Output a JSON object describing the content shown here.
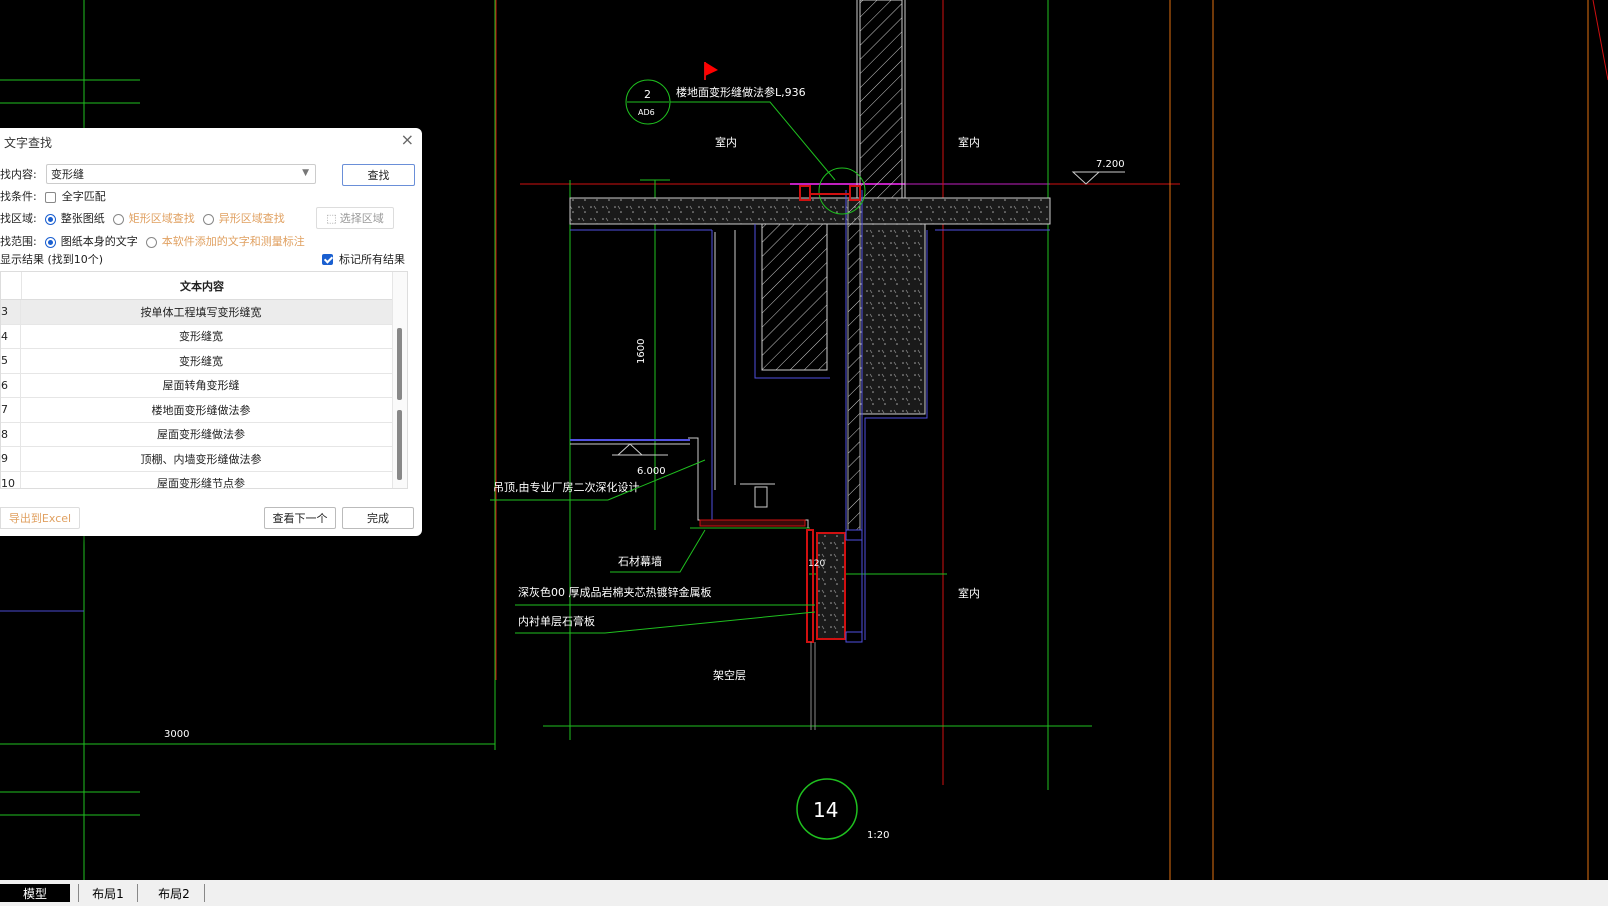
{
  "drawing": {
    "label_indoor_1": "室内",
    "label_indoor_2": "室内",
    "label_indoor_3": "室内",
    "label_overhead": "架空层",
    "elev_top": "7.200",
    "elev_mid": "6.000",
    "dim_vertical": "1600",
    "dim_horizontal": "3000",
    "dim_small": "120",
    "ref_circle_num": "2",
    "ref_circle_sheet": "AD6",
    "note_floor_joint": "楼地面变形缝做法参L,936",
    "note_ceiling": "吊顶,由专业厂房二次深化设计",
    "note_stone_wall": "石材幕墙",
    "note_panel": "深灰色00 厚成品岩棉夹芯热镀锌金属板",
    "note_lining": "内衬单层石膏板",
    "detail_num": "14",
    "detail_scale": "1:20"
  },
  "dialog": {
    "title": "文字查找",
    "close": "×",
    "search_label": "找内容:",
    "search_value": "变形缝",
    "find_button": "查找",
    "condition_label": "找条件:",
    "full_match": "全字匹配",
    "area_label": "找区域:",
    "area_whole": "整张图纸",
    "area_rect": "矩形区域查找",
    "area_irregular": "异形区域查找",
    "area_select": "选择区域",
    "range_label": "找范围:",
    "range_self": "图纸本身的文字",
    "range_added": "本软件添加的文字和测量标注",
    "results_label": "显示结果  (找到10个)",
    "mark_all": "标记所有结果",
    "column_header": "文本内容",
    "rows": [
      {
        "idx": "3",
        "text": "按单体工程填写变形缝宽"
      },
      {
        "idx": "4",
        "text": "变形缝宽"
      },
      {
        "idx": "5",
        "text": "变形缝宽"
      },
      {
        "idx": "6",
        "text": "屋面转角变形缝"
      },
      {
        "idx": "7",
        "text": "楼地面变形缝做法参"
      },
      {
        "idx": "8",
        "text": "屋面变形缝做法参"
      },
      {
        "idx": "9",
        "text": "顶棚、内墙变形缝做法参"
      },
      {
        "idx": "10",
        "text": "屋面变形缝节点参"
      }
    ],
    "export_button": "导出到Excel",
    "next_button": "查看下一个",
    "done_button": "完成"
  },
  "tabs": [
    "模型",
    "布局1",
    "布局2"
  ]
}
